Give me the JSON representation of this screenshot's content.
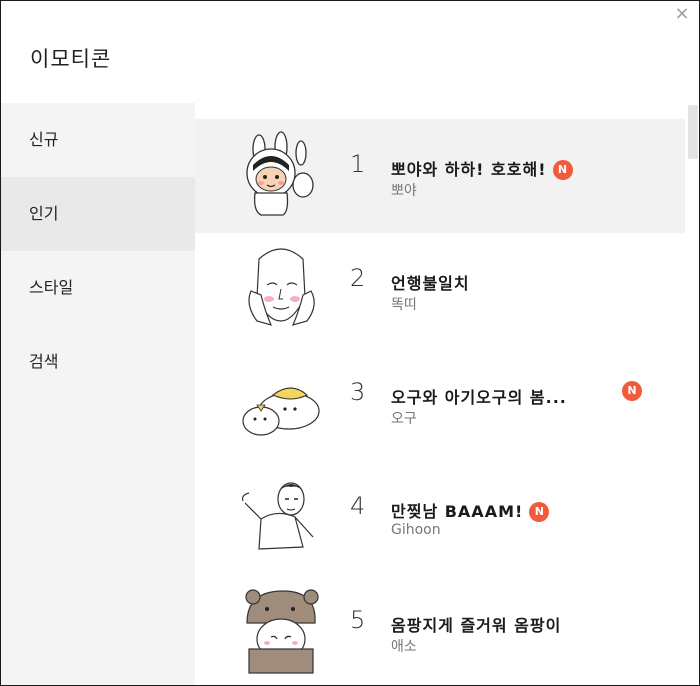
{
  "dialog": {
    "title": "이모티콘",
    "close_glyph": "×"
  },
  "sidebar": {
    "items": [
      {
        "label": "신규",
        "active": false
      },
      {
        "label": "인기",
        "active": true
      },
      {
        "label": "스타일",
        "active": false
      },
      {
        "label": "검색",
        "active": false
      }
    ]
  },
  "list": {
    "items": [
      {
        "rank": "1",
        "name": "뽀야와 하하! 호호해!",
        "artist": "뽀야",
        "new_badge": "N",
        "hovered": true
      },
      {
        "rank": "2",
        "name": "언행불일치",
        "artist": "똑띠",
        "new_badge": null,
        "hovered": false
      },
      {
        "rank": "3",
        "name": "오구와 아기오구의 봄...",
        "artist": "오구",
        "new_badge": "N",
        "hovered": false
      },
      {
        "rank": "4",
        "name": "만찢남 BAAAM!",
        "artist": "Gihoon",
        "new_badge": "N",
        "hovered": false
      },
      {
        "rank": "5",
        "name": "옴팡지게 즐거워 옴팡이",
        "artist": "애소",
        "new_badge": null,
        "hovered": false
      }
    ]
  },
  "colors": {
    "badge": "#f15a3b",
    "sidebar_bg": "#f4f4f4",
    "sidebar_active_bg": "#e9e9e9",
    "row_hover_bg": "#f2f2f2"
  }
}
